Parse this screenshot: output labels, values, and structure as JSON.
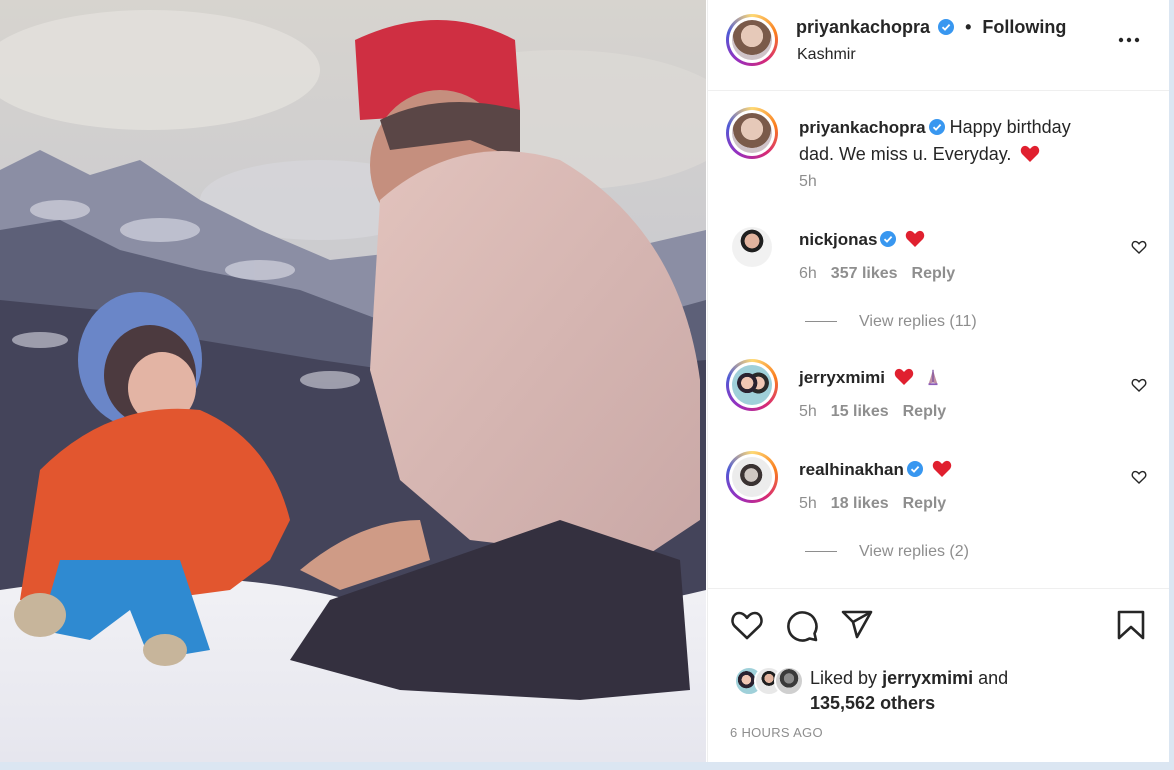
{
  "header": {
    "username": "priyankachopra",
    "separator": "•",
    "follow_status": "Following",
    "location": "Kashmir",
    "more_icon": "ellipsis-icon"
  },
  "caption": {
    "username": "priyankachopra",
    "text_line1": "Happy birthday",
    "text_line2": "dad. We miss u. Everyday.",
    "time": "5h"
  },
  "comments": [
    {
      "username": "nickjonas",
      "verified": true,
      "text": "heart-emoji",
      "time": "6h",
      "likes": "357 likes",
      "reply": "Reply",
      "view_replies": "View replies (11)"
    },
    {
      "username": "jerryxmimi",
      "verified": false,
      "text": "heart-emoji praying-hands-emoji",
      "time": "5h",
      "likes": "15 likes",
      "reply": "Reply"
    },
    {
      "username": "realhinakhan",
      "verified": true,
      "text": "heart-emoji",
      "time": "5h",
      "likes": "18 likes",
      "reply": "Reply",
      "view_replies": "View replies (2)"
    }
  ],
  "actions": {
    "icons": [
      "heart-icon",
      "comment-icon",
      "share-icon",
      "bookmark-icon"
    ]
  },
  "likes": {
    "prefix": "Liked by",
    "user": "jerryxmimi",
    "conj": "and",
    "others": "135,562 others"
  },
  "timestamp": "6 HOURS AGO",
  "colors": {
    "verified": "#3897f0",
    "heart_red": "#ed4956",
    "muted": "#8e8e8e",
    "text": "#262626"
  }
}
